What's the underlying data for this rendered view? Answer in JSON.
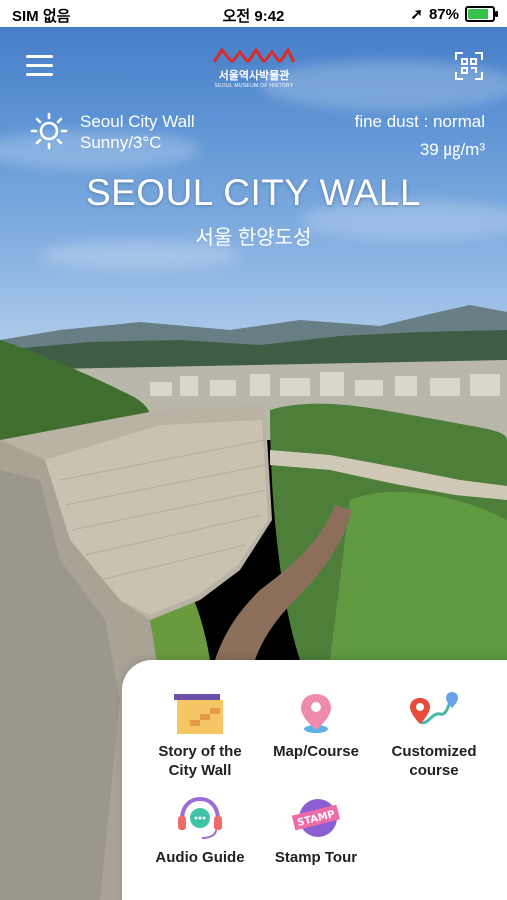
{
  "status_bar": {
    "carrier": "SIM 없음",
    "time": "오전 9:42",
    "battery": "87%"
  },
  "header": {
    "logo_korean": "서울역사박물관",
    "logo_english": "SEOUL MUSEUM OF HISTORY"
  },
  "weather": {
    "place": "Seoul City Wall",
    "condition": "Sunny/3°C",
    "dust_label": "fine dust : normal",
    "dust_value": "39 ㎍/m³"
  },
  "hero": {
    "title": "SEOUL CITY WALL",
    "subtitle": "서울 한양도성"
  },
  "menu": {
    "items": [
      {
        "label": "Story of the\nCity Wall",
        "icon": "city-wall-icon"
      },
      {
        "label": "Map/Course",
        "icon": "map-pin-icon"
      },
      {
        "label": "Customized\ncourse",
        "icon": "route-icon"
      },
      {
        "label": "Audio Guide",
        "icon": "headset-icon"
      },
      {
        "label": "Stamp Tour",
        "icon": "stamp-icon"
      }
    ]
  },
  "colors": {
    "sky_top": "#3f77c4",
    "logo_red": "#d92b2b",
    "wall_stone": "#b9b3a5",
    "forest_green": "#4d7f3a"
  }
}
